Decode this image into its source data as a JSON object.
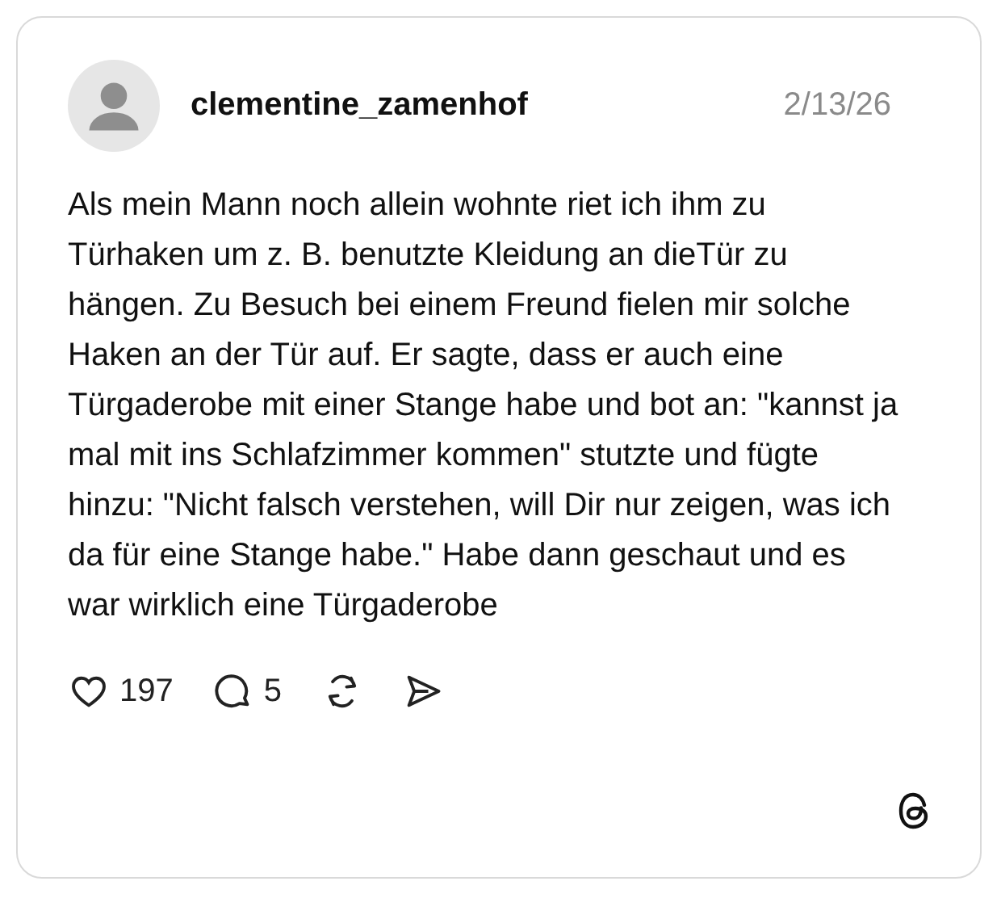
{
  "post": {
    "username": "clementine_zamenhof",
    "date": "2/13/26",
    "text": "Als mein Mann noch allein wohnte riet ich ihm zu Türhaken um z. B. benutzte Kleidung an dieTür zu hängen. Zu Besuch bei einem Freund fielen mir solche Haken an der Tür auf. Er sagte, dass er auch eine Türgaderobe mit einer Stange habe und bot an: \"kannst ja mal mit ins Schlafzimmer kommen\" stutzte und fügte hinzu: \"Nicht falsch verstehen, will Dir nur zeigen, was ich da für eine Stange habe.\" Habe dann geschaut und es war wirklich eine Türgaderobe",
    "actions": [
      {
        "kind": "like",
        "count": "197"
      },
      {
        "kind": "reply",
        "count": "5"
      },
      {
        "kind": "repost"
      },
      {
        "kind": "share"
      }
    ]
  }
}
